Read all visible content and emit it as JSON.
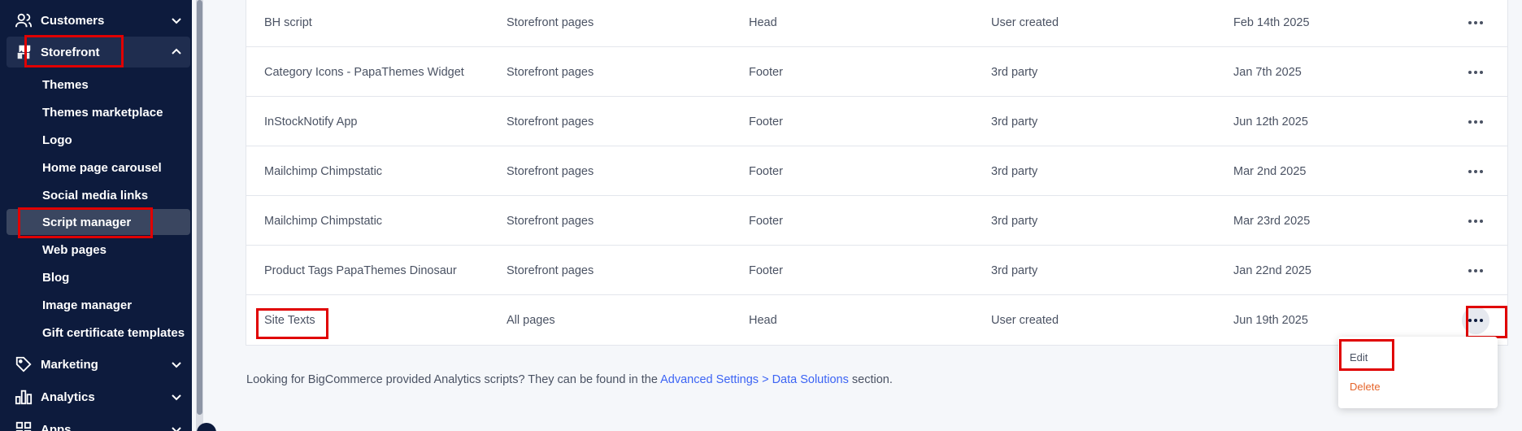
{
  "sidebar": {
    "items": [
      {
        "label": "Customers",
        "icon": "customers-icon"
      },
      {
        "label": "Storefront",
        "icon": "storefront-icon"
      },
      {
        "label": "Marketing",
        "icon": "tag-icon"
      },
      {
        "label": "Analytics",
        "icon": "analytics-icon"
      },
      {
        "label": "Apps",
        "icon": "apps-icon"
      }
    ],
    "subitems": [
      "Themes",
      "Themes marketplace",
      "Logo",
      "Home page carousel",
      "Social media links",
      "Script manager",
      "Web pages",
      "Blog",
      "Image manager",
      "Gift certificate templates"
    ],
    "selected_subitem": "Script manager"
  },
  "scripts": {
    "rows": [
      {
        "name": "BH script",
        "pages": "Storefront pages",
        "location": "Head",
        "created_by": "User created",
        "date": "Feb 14th 2025"
      },
      {
        "name": "Category Icons - PapaThemes Widget",
        "pages": "Storefront pages",
        "location": "Footer",
        "created_by": "3rd party",
        "date": "Jan 7th 2025"
      },
      {
        "name": "InStockNotify App",
        "pages": "Storefront pages",
        "location": "Footer",
        "created_by": "3rd party",
        "date": "Jun 12th 2025"
      },
      {
        "name": "Mailchimp Chimpstatic",
        "pages": "Storefront pages",
        "location": "Footer",
        "created_by": "3rd party",
        "date": "Mar 2nd 2025"
      },
      {
        "name": "Mailchimp Chimpstatic",
        "pages": "Storefront pages",
        "location": "Footer",
        "created_by": "3rd party",
        "date": "Mar 23rd 2025"
      },
      {
        "name": "Product Tags PapaThemes Dinosaur",
        "pages": "Storefront pages",
        "location": "Footer",
        "created_by": "3rd party",
        "date": "Jan 22nd 2025"
      },
      {
        "name": "Site Texts",
        "pages": "All pages",
        "location": "Head",
        "created_by": "User created",
        "date": "Jun 19th 2025"
      }
    ]
  },
  "footer": {
    "text_before": "Looking for BigCommerce provided Analytics scripts? They can be found in the ",
    "link_text": "Advanced Settings > Data Solutions",
    "text_after": " section."
  },
  "menu": {
    "edit_label": "Edit",
    "delete_label": "Delete"
  },
  "colors": {
    "sidebar_bg": "#0d1b3d",
    "link": "#3c64f4",
    "delete": "#e5642a",
    "highlight": "#e00000"
  }
}
